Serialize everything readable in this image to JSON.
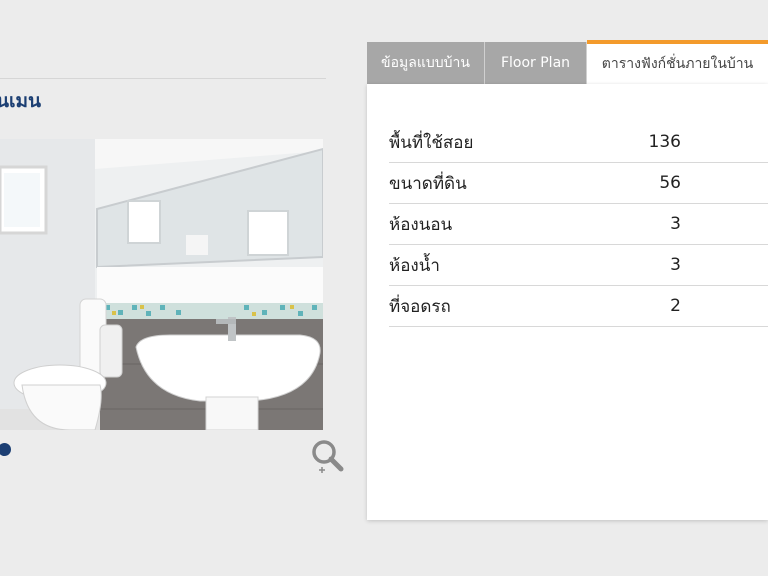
{
  "title": "นเมน",
  "gallery": {
    "image": "bathroom-photo",
    "zoom_icon": "zoom-in-icon",
    "dot_color": "#1c3f73"
  },
  "tabs": [
    {
      "label": "ข้อมูลแบบบ้าน",
      "active": false
    },
    {
      "label": "Floor Plan",
      "active": false
    },
    {
      "label": "ตารางฟังก์ชั่นภายในบ้าน",
      "active": true
    }
  ],
  "specs": [
    {
      "label": "พื้นที่ใช้สอย",
      "value": "136"
    },
    {
      "label": "ขนาดที่ดิน",
      "value": "56"
    },
    {
      "label": "ห้องนอน",
      "value": "3"
    },
    {
      "label": "ห้องน้ำ",
      "value": "3"
    },
    {
      "label": "ที่จอดรถ",
      "value": "2"
    }
  ],
  "colors": {
    "accent": "#f39a2b",
    "title": "#1c3f73",
    "tab_inactive": "#a7a7a7"
  }
}
